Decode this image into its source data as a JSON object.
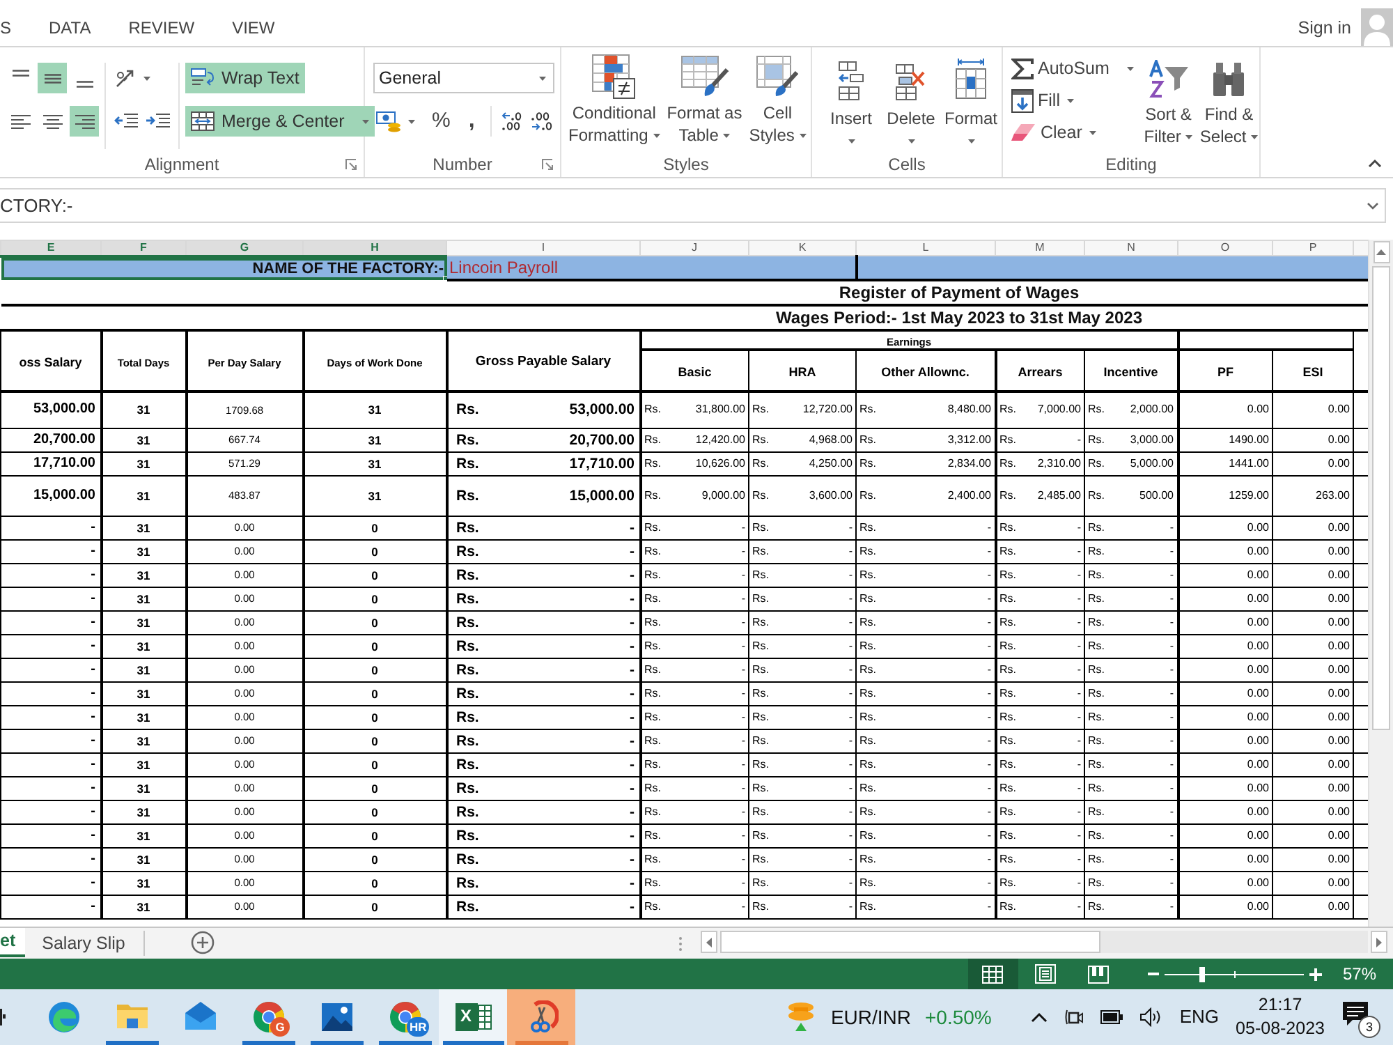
{
  "ribbon_tabs": [
    {
      "label": "S"
    },
    {
      "label": "DATA"
    },
    {
      "label": "REVIEW"
    },
    {
      "label": "VIEW"
    }
  ],
  "account": {
    "label": "Sign in"
  },
  "alignment": {
    "label": "Alignment",
    "vertical": [
      {
        "kind": "top",
        "selected": false
      },
      {
        "kind": "middle",
        "selected": true
      },
      {
        "kind": "bottom",
        "selected": false
      }
    ],
    "horizontal": [
      {
        "kind": "left",
        "selected": false
      },
      {
        "kind": "center",
        "selected": false
      },
      {
        "kind": "right",
        "selected": true
      }
    ],
    "wrap_text": {
      "label": "Wrap Text",
      "selected": true
    },
    "merge": {
      "label": "Merge & Center",
      "selected": true
    }
  },
  "number": {
    "label": "Number",
    "format": "General",
    "percent": "%",
    "comma": ","
  },
  "styles": {
    "label": "Styles",
    "buttons": [
      {
        "kind": "conditional",
        "lines": [
          "Conditional",
          "Formatting"
        ]
      },
      {
        "kind": "table",
        "lines": [
          "Format as",
          "Table"
        ]
      },
      {
        "kind": "cell_styles",
        "lines": [
          "Cell",
          "Styles"
        ]
      }
    ]
  },
  "cells": {
    "label": "Cells",
    "buttons": [
      {
        "kind": "insert",
        "label": "Insert"
      },
      {
        "kind": "delete",
        "label": "Delete"
      },
      {
        "kind": "format",
        "label": "Format"
      }
    ]
  },
  "editing": {
    "label": "Editing",
    "commands": [
      {
        "kind": "autosum",
        "label": "AutoSum"
      },
      {
        "kind": "fill",
        "label": "Fill"
      },
      {
        "kind": "clear",
        "label": "Clear"
      }
    ],
    "buttons": [
      {
        "kind": "sort",
        "lines": [
          "Sort &",
          "Filter"
        ]
      },
      {
        "kind": "find",
        "lines": [
          "Find &",
          "Select"
        ]
      }
    ]
  },
  "formula_bar": {
    "value": "CTORY:-"
  },
  "sheet": {
    "columns": [
      {
        "letter": "E",
        "selected": true
      },
      {
        "letter": "F",
        "selected": true
      },
      {
        "letter": "G",
        "selected": true
      },
      {
        "letter": "H",
        "selected": true
      },
      {
        "letter": "I",
        "selected": false
      },
      {
        "letter": "J",
        "selected": false
      },
      {
        "letter": "K",
        "selected": false
      },
      {
        "letter": "L",
        "selected": false
      },
      {
        "letter": "M",
        "selected": false
      },
      {
        "letter": "N",
        "selected": false
      },
      {
        "letter": "O",
        "selected": false
      },
      {
        "letter": "P",
        "selected": false
      }
    ],
    "factory_label": {
      "text": "NAME OF THE FACTORY:-",
      "selected": true
    },
    "factory_name": "Lincoin Payroll",
    "title": "Register of Payment of Wages",
    "period": "Wages Period:- 1st May 2023 to 31st May 2023",
    "earnings_label": "Earnings",
    "headers": [
      "oss Salary",
      "Total Days",
      "Per Day Salary",
      "Days of Work Done",
      "Gross Payable Salary",
      "Basic",
      "HRA",
      "Other Allownc.",
      "Arrears",
      "Incentive",
      "PF",
      "ESI"
    ],
    "rows": [
      [
        "53,000.00",
        "31",
        "1709.68",
        "31",
        [
          "Rs.",
          "53,000.00"
        ],
        [
          "Rs.",
          "31,800.00"
        ],
        [
          "Rs.",
          "12,720.00"
        ],
        [
          "Rs.",
          "8,480.00"
        ],
        [
          "Rs.",
          "7,000.00"
        ],
        [
          "Rs.",
          "2,000.00"
        ],
        "0.00",
        "0.00"
      ],
      [
        "20,700.00",
        "31",
        "667.74",
        "31",
        [
          "Rs.",
          "20,700.00"
        ],
        [
          "Rs.",
          "12,420.00"
        ],
        [
          "Rs.",
          "4,968.00"
        ],
        [
          "Rs.",
          "3,312.00"
        ],
        [
          "Rs.",
          "-"
        ],
        [
          "Rs.",
          "3,000.00"
        ],
        "1490.00",
        "0.00"
      ],
      [
        "17,710.00",
        "31",
        "571.29",
        "31",
        [
          "Rs.",
          "17,710.00"
        ],
        [
          "Rs.",
          "10,626.00"
        ],
        [
          "Rs.",
          "4,250.00"
        ],
        [
          "Rs.",
          "2,834.00"
        ],
        [
          "Rs.",
          "2,310.00"
        ],
        [
          "Rs.",
          "5,000.00"
        ],
        "1441.00",
        "0.00"
      ],
      [
        "15,000.00",
        "31",
        "483.87",
        "31",
        [
          "Rs.",
          "15,000.00"
        ],
        [
          "Rs.",
          "9,000.00"
        ],
        [
          "Rs.",
          "3,600.00"
        ],
        [
          "Rs.",
          "2,400.00"
        ],
        [
          "Rs.",
          "2,485.00"
        ],
        [
          "Rs.",
          "500.00"
        ],
        "1259.00",
        "263.00"
      ],
      [
        "-",
        "31",
        "0.00",
        "0",
        [
          "Rs.",
          "-"
        ],
        [
          "Rs.",
          "-"
        ],
        [
          "Rs.",
          "-"
        ],
        [
          "Rs.",
          "-"
        ],
        [
          "Rs.",
          "-"
        ],
        [
          "Rs.",
          "-"
        ],
        "0.00",
        "0.00"
      ],
      [
        "-",
        "31",
        "0.00",
        "0",
        [
          "Rs.",
          "-"
        ],
        [
          "Rs.",
          "-"
        ],
        [
          "Rs.",
          "-"
        ],
        [
          "Rs.",
          "-"
        ],
        [
          "Rs.",
          "-"
        ],
        [
          "Rs.",
          "-"
        ],
        "0.00",
        "0.00"
      ],
      [
        "-",
        "31",
        "0.00",
        "0",
        [
          "Rs.",
          "-"
        ],
        [
          "Rs.",
          "-"
        ],
        [
          "Rs.",
          "-"
        ],
        [
          "Rs.",
          "-"
        ],
        [
          "Rs.",
          "-"
        ],
        [
          "Rs.",
          "-"
        ],
        "0.00",
        "0.00"
      ],
      [
        "-",
        "31",
        "0.00",
        "0",
        [
          "Rs.",
          "-"
        ],
        [
          "Rs.",
          "-"
        ],
        [
          "Rs.",
          "-"
        ],
        [
          "Rs.",
          "-"
        ],
        [
          "Rs.",
          "-"
        ],
        [
          "Rs.",
          "-"
        ],
        "0.00",
        "0.00"
      ],
      [
        "-",
        "31",
        "0.00",
        "0",
        [
          "Rs.",
          "-"
        ],
        [
          "Rs.",
          "-"
        ],
        [
          "Rs.",
          "-"
        ],
        [
          "Rs.",
          "-"
        ],
        [
          "Rs.",
          "-"
        ],
        [
          "Rs.",
          "-"
        ],
        "0.00",
        "0.00"
      ],
      [
        "-",
        "31",
        "0.00",
        "0",
        [
          "Rs.",
          "-"
        ],
        [
          "Rs.",
          "-"
        ],
        [
          "Rs.",
          "-"
        ],
        [
          "Rs.",
          "-"
        ],
        [
          "Rs.",
          "-"
        ],
        [
          "Rs.",
          "-"
        ],
        "0.00",
        "0.00"
      ],
      [
        "-",
        "31",
        "0.00",
        "0",
        [
          "Rs.",
          "-"
        ],
        [
          "Rs.",
          "-"
        ],
        [
          "Rs.",
          "-"
        ],
        [
          "Rs.",
          "-"
        ],
        [
          "Rs.",
          "-"
        ],
        [
          "Rs.",
          "-"
        ],
        "0.00",
        "0.00"
      ],
      [
        "-",
        "31",
        "0.00",
        "0",
        [
          "Rs.",
          "-"
        ],
        [
          "Rs.",
          "-"
        ],
        [
          "Rs.",
          "-"
        ],
        [
          "Rs.",
          "-"
        ],
        [
          "Rs.",
          "-"
        ],
        [
          "Rs.",
          "-"
        ],
        "0.00",
        "0.00"
      ],
      [
        "-",
        "31",
        "0.00",
        "0",
        [
          "Rs.",
          "-"
        ],
        [
          "Rs.",
          "-"
        ],
        [
          "Rs.",
          "-"
        ],
        [
          "Rs.",
          "-"
        ],
        [
          "Rs.",
          "-"
        ],
        [
          "Rs.",
          "-"
        ],
        "0.00",
        "0.00"
      ],
      [
        "-",
        "31",
        "0.00",
        "0",
        [
          "Rs.",
          "-"
        ],
        [
          "Rs.",
          "-"
        ],
        [
          "Rs.",
          "-"
        ],
        [
          "Rs.",
          "-"
        ],
        [
          "Rs.",
          "-"
        ],
        [
          "Rs.",
          "-"
        ],
        "0.00",
        "0.00"
      ],
      [
        "-",
        "31",
        "0.00",
        "0",
        [
          "Rs.",
          "-"
        ],
        [
          "Rs.",
          "-"
        ],
        [
          "Rs.",
          "-"
        ],
        [
          "Rs.",
          "-"
        ],
        [
          "Rs.",
          "-"
        ],
        [
          "Rs.",
          "-"
        ],
        "0.00",
        "0.00"
      ],
      [
        "-",
        "31",
        "0.00",
        "0",
        [
          "Rs.",
          "-"
        ],
        [
          "Rs.",
          "-"
        ],
        [
          "Rs.",
          "-"
        ],
        [
          "Rs.",
          "-"
        ],
        [
          "Rs.",
          "-"
        ],
        [
          "Rs.",
          "-"
        ],
        "0.00",
        "0.00"
      ],
      [
        "-",
        "31",
        "0.00",
        "0",
        [
          "Rs.",
          "-"
        ],
        [
          "Rs.",
          "-"
        ],
        [
          "Rs.",
          "-"
        ],
        [
          "Rs.",
          "-"
        ],
        [
          "Rs.",
          "-"
        ],
        [
          "Rs.",
          "-"
        ],
        "0.00",
        "0.00"
      ],
      [
        "-",
        "31",
        "0.00",
        "0",
        [
          "Rs.",
          "-"
        ],
        [
          "Rs.",
          "-"
        ],
        [
          "Rs.",
          "-"
        ],
        [
          "Rs.",
          "-"
        ],
        [
          "Rs.",
          "-"
        ],
        [
          "Rs.",
          "-"
        ],
        "0.00",
        "0.00"
      ],
      [
        "-",
        "31",
        "0.00",
        "0",
        [
          "Rs.",
          "-"
        ],
        [
          "Rs.",
          "-"
        ],
        [
          "Rs.",
          "-"
        ],
        [
          "Rs.",
          "-"
        ],
        [
          "Rs.",
          "-"
        ],
        [
          "Rs.",
          "-"
        ],
        "0.00",
        "0.00"
      ],
      [
        "-",
        "31",
        "0.00",
        "0",
        [
          "Rs.",
          "-"
        ],
        [
          "Rs.",
          "-"
        ],
        [
          "Rs.",
          "-"
        ],
        [
          "Rs.",
          "-"
        ],
        [
          "Rs.",
          "-"
        ],
        [
          "Rs.",
          "-"
        ],
        "0.00",
        "0.00"
      ],
      [
        "-",
        "31",
        "0.00",
        "0",
        [
          "Rs.",
          "-"
        ],
        [
          "Rs.",
          "-"
        ],
        [
          "Rs.",
          "-"
        ],
        [
          "Rs.",
          "-"
        ],
        [
          "Rs.",
          "-"
        ],
        [
          "Rs.",
          "-"
        ],
        "0.00",
        "0.00"
      ]
    ]
  },
  "sheet_tabs": [
    {
      "label": "et",
      "selected": true
    },
    {
      "label": "Salary Slip",
      "selected": false
    }
  ],
  "status_bar": {
    "views": [
      {
        "kind": "normal",
        "selected": true
      },
      {
        "kind": "page_layout",
        "selected": false
      },
      {
        "kind": "page_break",
        "selected": false
      }
    ],
    "zoom": {
      "level": 0.27,
      "reading": "57%"
    }
  },
  "taskbar": {
    "apps": [
      {
        "kind": "edge",
        "running": false,
        "active": false,
        "flashing": false
      },
      {
        "kind": "explorer",
        "running": true,
        "active": false,
        "flashing": false
      },
      {
        "kind": "mail",
        "running": false,
        "active": false,
        "flashing": false
      },
      {
        "kind": "chrome",
        "badge": "G",
        "color": "#e4572e",
        "running": true,
        "active": false,
        "flashing": false
      },
      {
        "kind": "photos",
        "running": true,
        "active": false,
        "flashing": false
      },
      {
        "kind": "chrome",
        "badge": "HR",
        "color": "#1e76d3",
        "running": true,
        "active": false,
        "flashing": false
      },
      {
        "kind": "excel",
        "letter": "X",
        "running": true,
        "active": true,
        "flashing": false
      },
      {
        "kind": "snip",
        "running": true,
        "active": false,
        "flashing": true
      }
    ],
    "widget": {
      "pair": "EUR/INR",
      "change": "+0.50%"
    },
    "tray": {
      "language": "ENG",
      "time": "21:17",
      "date": "05-08-2023",
      "notifications": "3"
    }
  }
}
